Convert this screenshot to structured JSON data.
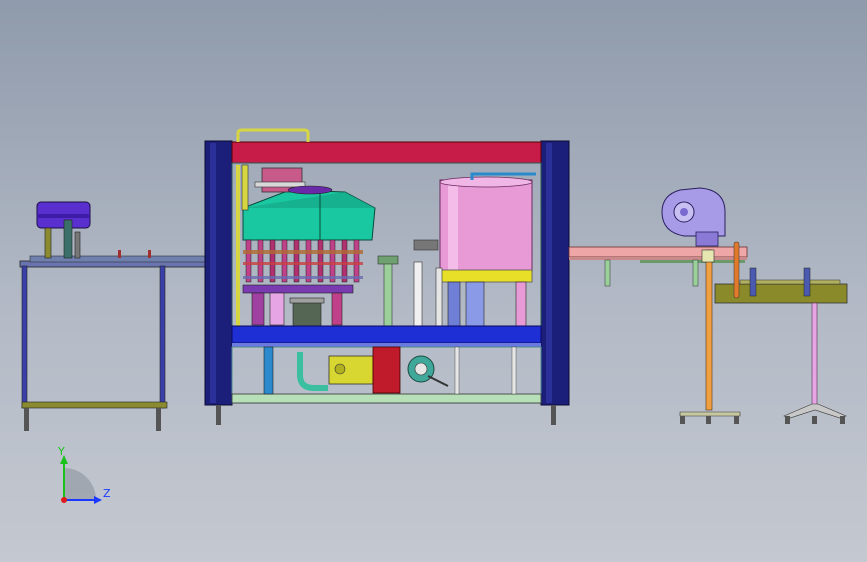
{
  "axes": {
    "y_label": "Y",
    "z_label": "Z",
    "y_color": "#19c319",
    "z_color": "#1a38ff",
    "origin_color": "#e01a1a"
  },
  "colors": {
    "frame_column": "#1c1f7a",
    "top_beam": "#c81c48",
    "blue_table": "#1f2fd6",
    "filler_bowl": "#19c7a0",
    "tank": "#e89ad6",
    "tank_base": "#e8e028",
    "capper_head": "#5a2fd0",
    "fan": "#a79ae6",
    "conveyor_pink": "#eea6a6",
    "conveyor_olive": "#8a8a2a",
    "motor_box": "#bf1b2a",
    "motor_yellow": "#d8d630"
  },
  "icons": [
    "axis-triad-icon"
  ]
}
